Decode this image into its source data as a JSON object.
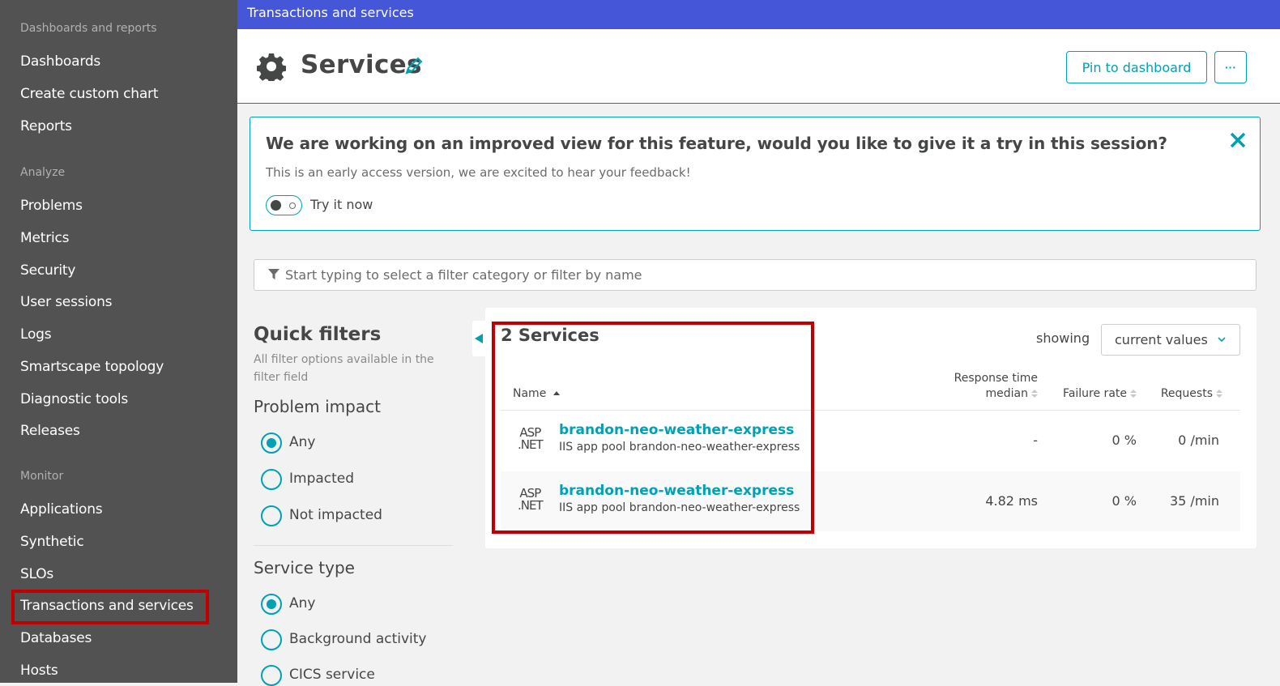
{
  "sidebar": {
    "sections": [
      {
        "title": "Dashboards and reports",
        "items": [
          "Dashboards",
          "Create custom chart",
          "Reports"
        ]
      },
      {
        "title": "Analyze",
        "items": [
          "Problems",
          "Metrics",
          "Security",
          "User sessions",
          "Logs",
          "Smartscape topology",
          "Diagnostic tools",
          "Releases"
        ]
      },
      {
        "title": "Monitor",
        "items": [
          "Applications",
          "Synthetic",
          "SLOs",
          "Transactions and services",
          "Databases",
          "Hosts"
        ]
      }
    ],
    "active_item": "Transactions and services"
  },
  "topbar": {
    "title": "Transactions and services"
  },
  "header": {
    "title": "Services",
    "pin_label": "Pin to dashboard",
    "more_label": "···"
  },
  "banner": {
    "title": "We are working on an improved view for this feature, would you like to give it a try in this session?",
    "subtitle": "This is an early access version, we are excited to hear your feedback!",
    "toggle_label": "Try it now",
    "toggle_on": false
  },
  "filter": {
    "placeholder": "Start typing to select a filter category or filter by name",
    "value": ""
  },
  "quick_filters": {
    "title": "Quick filters",
    "subtitle": "All filter options available in the filter field",
    "groups": [
      {
        "title": "Problem impact",
        "options": [
          "Any",
          "Impacted",
          "Not impacted"
        ],
        "selected": "Any"
      },
      {
        "title": "Service type",
        "options": [
          "Any",
          "Background activity",
          "CICS service"
        ],
        "selected": "Any"
      }
    ]
  },
  "services": {
    "count_label": "2 Services",
    "showing_label": "showing",
    "showing_value": "current values",
    "columns": {
      "name": "Name",
      "response_l1": "Response time",
      "response_l2": "median",
      "failure": "Failure rate",
      "requests": "Requests"
    },
    "rows": [
      {
        "tech": [
          "ASP",
          ".NET"
        ],
        "name": "brandon-neo-weather-express",
        "sub": "IIS app pool brandon-neo-weather-express",
        "response": "-",
        "failure": "0 %",
        "requests": "0 /min"
      },
      {
        "tech": [
          "ASP",
          ".NET"
        ],
        "name": "brandon-neo-weather-express",
        "sub": "IIS app pool brandon-neo-weather-express",
        "response": "4.82 ms",
        "failure": "0 %",
        "requests": "35 /min"
      }
    ]
  },
  "colors": {
    "accent": "#00a1b2",
    "topbar": "#4556d8",
    "sidebar": "#525252",
    "highlight": "#c00000"
  }
}
